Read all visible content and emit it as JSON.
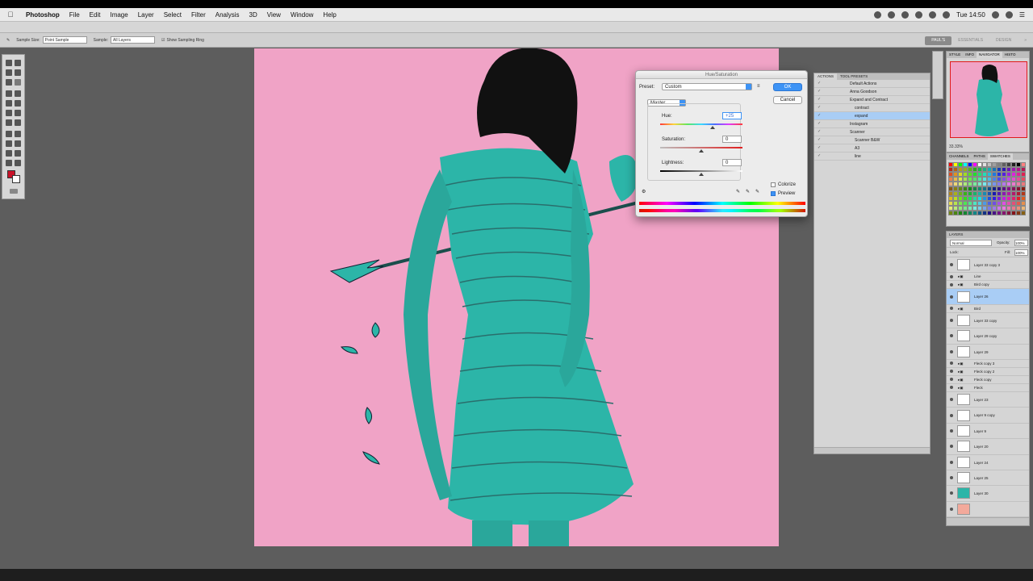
{
  "menubar": {
    "app": "Photoshop",
    "items": [
      "File",
      "Edit",
      "Image",
      "Layer",
      "Select",
      "Filter",
      "Analysis",
      "3D",
      "View",
      "Window",
      "Help"
    ],
    "clock": "Tue 14:50"
  },
  "optionsbar": {
    "sample_size_label": "Sample Size:",
    "sample_size_value": "Point Sample",
    "sample_label": "Sample:",
    "sample_value": "All Layers",
    "show_ring": "Show Sampling Ring"
  },
  "workspaces": [
    "PAUL'S",
    "ESSENTIALS",
    "DESIGN"
  ],
  "dialog": {
    "title": "Hue/Saturation",
    "preset_label": "Preset:",
    "preset_value": "Custom",
    "ok": "OK",
    "cancel": "Cancel",
    "channel": "Master",
    "hue_label": "Hue:",
    "hue_value": "+25",
    "saturation_label": "Saturation:",
    "saturation_value": "0",
    "lightness_label": "Lightness:",
    "lightness_value": "0",
    "colorize_label": "Colorize",
    "preview_label": "Preview",
    "colorize_checked": false,
    "preview_checked": true
  },
  "actions_panel": {
    "tabs": [
      "ACTIONS",
      "TOOL PRESETS"
    ],
    "rows": [
      {
        "label": "Default Actions",
        "selected": false
      },
      {
        "label": "Anna Goodson",
        "selected": false
      },
      {
        "label": "Expand and Contract",
        "selected": false
      },
      {
        "label": "contract",
        "selected": false
      },
      {
        "label": "expand",
        "selected": true
      },
      {
        "label": "Instagram",
        "selected": false
      },
      {
        "label": "Scanner",
        "selected": false
      },
      {
        "label": "Scanner B&W",
        "selected": false
      },
      {
        "label": "A3",
        "selected": false
      },
      {
        "label": "line",
        "selected": false
      }
    ]
  },
  "navigator_panel": {
    "tabs": [
      "STYLE",
      "INFO",
      "NAVIGATOR",
      "HISTO"
    ],
    "zoom": "33.33%"
  },
  "swatches_panel": {
    "tabs": [
      "CHANNELS",
      "PATHS",
      "SWATCHES"
    ]
  },
  "layers_panel": {
    "tab": "LAYERS",
    "blend_mode": "Normal",
    "opacity_label": "Opacity:",
    "opacity_value": "100%",
    "lock_label": "Lock:",
    "fill_label": "Fill:",
    "fill_value": "100%",
    "layers": [
      {
        "name": "Layer 33 copy 3",
        "type": "thumb",
        "selected": false
      },
      {
        "name": "Line",
        "type": "group",
        "selected": false
      },
      {
        "name": "Bird copy",
        "type": "group",
        "selected": false
      },
      {
        "name": "Layer 26",
        "type": "thumb",
        "selected": true
      },
      {
        "name": "Bird",
        "type": "group",
        "selected": false
      },
      {
        "name": "Layer 33 copy",
        "type": "thumb",
        "selected": false
      },
      {
        "name": "Layer 29 copy",
        "type": "thumb",
        "selected": false
      },
      {
        "name": "Layer 29",
        "type": "thumb",
        "selected": false
      },
      {
        "name": "Fleck copy 3",
        "type": "group",
        "selected": false
      },
      {
        "name": "Fleck copy 2",
        "type": "group",
        "selected": false
      },
      {
        "name": "Fleck copy",
        "type": "group",
        "selected": false
      },
      {
        "name": "Fleck",
        "type": "group",
        "selected": false
      },
      {
        "name": "Layer 23",
        "type": "thumb",
        "selected": false
      },
      {
        "name": "Layer 9 copy",
        "type": "thumb",
        "selected": false
      },
      {
        "name": "Layer 9",
        "type": "thumb",
        "selected": false
      },
      {
        "name": "Layer 20",
        "type": "thumb",
        "selected": false
      },
      {
        "name": "Layer 24",
        "type": "thumb",
        "selected": false
      },
      {
        "name": "Layer 25",
        "type": "thumb",
        "selected": false
      },
      {
        "name": "Layer 30",
        "type": "teal",
        "selected": false
      },
      {
        "name": "",
        "type": "salmon",
        "selected": false
      }
    ]
  },
  "colors": {
    "canvas_bg": "#f0a3c6",
    "figure_teal": "#2cb5a8",
    "hair": "#111111",
    "foreground_swatch": "#c9132a",
    "accent_blue": "#3d93f5"
  }
}
